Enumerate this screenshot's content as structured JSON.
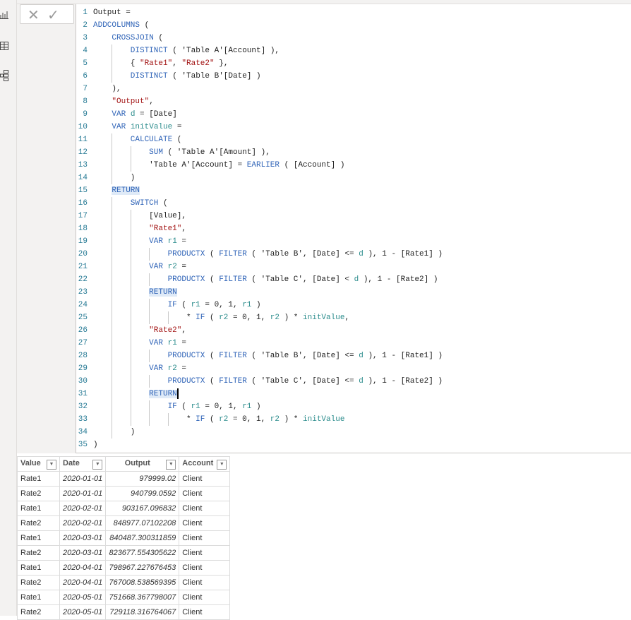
{
  "sidebar": {
    "icons": [
      "report-view-icon",
      "table-view-icon",
      "model-view-icon"
    ]
  },
  "formula_bar": {
    "cancel_icon": "✕",
    "commit_icon": "✓"
  },
  "editor": {
    "cursor_line": 31,
    "lines": [
      {
        "indent": 0,
        "tokens": [
          [
            "t",
            "Output ="
          ]
        ]
      },
      {
        "indent": 0,
        "tokens": [
          [
            "k",
            "ADDCOLUMNS"
          ],
          [
            "t",
            " ("
          ]
        ]
      },
      {
        "indent": 1,
        "tokens": [
          [
            "k",
            "CROSSJOIN"
          ],
          [
            "t",
            " ("
          ]
        ]
      },
      {
        "indent": 2,
        "tokens": [
          [
            "k",
            "DISTINCT"
          ],
          [
            "t",
            " ( 'Table A'[Account] ),"
          ]
        ]
      },
      {
        "indent": 2,
        "tokens": [
          [
            "t",
            "{ "
          ],
          [
            "s",
            "\"Rate1\""
          ],
          [
            "t",
            ", "
          ],
          [
            "s",
            "\"Rate2\""
          ],
          [
            "t",
            " },"
          ]
        ]
      },
      {
        "indent": 2,
        "tokens": [
          [
            "k",
            "DISTINCT"
          ],
          [
            "t",
            " ( 'Table B'[Date] )"
          ]
        ]
      },
      {
        "indent": 1,
        "tokens": [
          [
            "t",
            "),"
          ]
        ]
      },
      {
        "indent": 1,
        "tokens": [
          [
            "s",
            "\"Output\""
          ],
          [
            "t",
            ","
          ]
        ]
      },
      {
        "indent": 1,
        "tokens": [
          [
            "k",
            "VAR"
          ],
          [
            "t",
            " "
          ],
          [
            "v",
            "d"
          ],
          [
            "t",
            " = [Date]"
          ]
        ]
      },
      {
        "indent": 1,
        "tokens": [
          [
            "k",
            "VAR"
          ],
          [
            "t",
            " "
          ],
          [
            "v",
            "initValue"
          ],
          [
            "t",
            " ="
          ]
        ]
      },
      {
        "indent": 2,
        "tokens": [
          [
            "k",
            "CALCULATE"
          ],
          [
            "t",
            " ("
          ]
        ]
      },
      {
        "indent": 3,
        "tokens": [
          [
            "k",
            "SUM"
          ],
          [
            "t",
            " ( 'Table A'[Amount] ),"
          ]
        ]
      },
      {
        "indent": 3,
        "tokens": [
          [
            "t",
            "'Table A'[Account] = "
          ],
          [
            "k",
            "EARLIER"
          ],
          [
            "t",
            " ( [Account] )"
          ]
        ]
      },
      {
        "indent": 2,
        "tokens": [
          [
            "t",
            ")"
          ]
        ]
      },
      {
        "indent": 1,
        "tokens": [
          [
            "k",
            "RETURN"
          ]
        ],
        "highlight": true
      },
      {
        "indent": 2,
        "tokens": [
          [
            "k",
            "SWITCH"
          ],
          [
            "t",
            " ("
          ]
        ]
      },
      {
        "indent": 3,
        "tokens": [
          [
            "t",
            "[Value],"
          ]
        ]
      },
      {
        "indent": 3,
        "tokens": [
          [
            "s",
            "\"Rate1\""
          ],
          [
            "t",
            ","
          ]
        ]
      },
      {
        "indent": 3,
        "tokens": [
          [
            "k",
            "VAR"
          ],
          [
            "t",
            " "
          ],
          [
            "v",
            "r1"
          ],
          [
            "t",
            " ="
          ]
        ]
      },
      {
        "indent": 4,
        "tokens": [
          [
            "k",
            "PRODUCTX"
          ],
          [
            "t",
            " ( "
          ],
          [
            "k",
            "FILTER"
          ],
          [
            "t",
            " ( 'Table B', [Date] <= "
          ],
          [
            "v",
            "d"
          ],
          [
            "t",
            " ), 1 - [Rate1] )"
          ]
        ]
      },
      {
        "indent": 3,
        "tokens": [
          [
            "k",
            "VAR"
          ],
          [
            "t",
            " "
          ],
          [
            "v",
            "r2"
          ],
          [
            "t",
            " ="
          ]
        ]
      },
      {
        "indent": 4,
        "tokens": [
          [
            "k",
            "PRODUCTX"
          ],
          [
            "t",
            " ( "
          ],
          [
            "k",
            "FILTER"
          ],
          [
            "t",
            " ( 'Table C', [Date] < "
          ],
          [
            "v",
            "d"
          ],
          [
            "t",
            " ), 1 - [Rate2] )"
          ]
        ]
      },
      {
        "indent": 3,
        "tokens": [
          [
            "k",
            "RETURN"
          ]
        ],
        "highlight": true
      },
      {
        "indent": 4,
        "tokens": [
          [
            "k",
            "IF"
          ],
          [
            "t",
            " ( "
          ],
          [
            "v",
            "r1"
          ],
          [
            "t",
            " = 0, 1, "
          ],
          [
            "v",
            "r1"
          ],
          [
            "t",
            " )"
          ]
        ]
      },
      {
        "indent": 5,
        "tokens": [
          [
            "t",
            "* "
          ],
          [
            "k",
            "IF"
          ],
          [
            "t",
            " ( "
          ],
          [
            "v",
            "r2"
          ],
          [
            "t",
            " = 0, 1, "
          ],
          [
            "v",
            "r2"
          ],
          [
            "t",
            " ) * "
          ],
          [
            "v",
            "initValue"
          ],
          [
            "t",
            ","
          ]
        ]
      },
      {
        "indent": 3,
        "tokens": [
          [
            "s",
            "\"Rate2\""
          ],
          [
            "t",
            ","
          ]
        ]
      },
      {
        "indent": 3,
        "tokens": [
          [
            "k",
            "VAR"
          ],
          [
            "t",
            " "
          ],
          [
            "v",
            "r1"
          ],
          [
            "t",
            " ="
          ]
        ]
      },
      {
        "indent": 4,
        "tokens": [
          [
            "k",
            "PRODUCTX"
          ],
          [
            "t",
            " ( "
          ],
          [
            "k",
            "FILTER"
          ],
          [
            "t",
            " ( 'Table B', [Date] <= "
          ],
          [
            "v",
            "d"
          ],
          [
            "t",
            " ), 1 - [Rate1] )"
          ]
        ]
      },
      {
        "indent": 3,
        "tokens": [
          [
            "k",
            "VAR"
          ],
          [
            "t",
            " "
          ],
          [
            "v",
            "r2"
          ],
          [
            "t",
            " ="
          ]
        ]
      },
      {
        "indent": 4,
        "tokens": [
          [
            "k",
            "PRODUCTX"
          ],
          [
            "t",
            " ( "
          ],
          [
            "k",
            "FILTER"
          ],
          [
            "t",
            " ( 'Table C', [Date] <= "
          ],
          [
            "v",
            "d"
          ],
          [
            "t",
            " ), 1 - [Rate2] )"
          ]
        ]
      },
      {
        "indent": 3,
        "tokens": [
          [
            "k",
            "RETURN"
          ]
        ],
        "highlight": true
      },
      {
        "indent": 4,
        "tokens": [
          [
            "k",
            "IF"
          ],
          [
            "t",
            " ( "
          ],
          [
            "v",
            "r1"
          ],
          [
            "t",
            " = 0, 1, "
          ],
          [
            "v",
            "r1"
          ],
          [
            "t",
            " )"
          ]
        ]
      },
      {
        "indent": 5,
        "tokens": [
          [
            "t",
            "* "
          ],
          [
            "k",
            "IF"
          ],
          [
            "t",
            " ( "
          ],
          [
            "v",
            "r2"
          ],
          [
            "t",
            " = 0, 1, "
          ],
          [
            "v",
            "r2"
          ],
          [
            "t",
            " ) * "
          ],
          [
            "v",
            "initValue"
          ]
        ]
      },
      {
        "indent": 2,
        "tokens": [
          [
            "t",
            ")"
          ]
        ]
      },
      {
        "indent": 0,
        "tokens": [
          [
            "t",
            ")"
          ]
        ]
      }
    ]
  },
  "table": {
    "columns": [
      "Value",
      "Date",
      "Output",
      "Account"
    ],
    "filter_icon": "▼",
    "rows": [
      [
        "Rate1",
        "2020-01-01",
        "979999.02",
        "Client"
      ],
      [
        "Rate2",
        "2020-01-01",
        "940799.0592",
        "Client"
      ],
      [
        "Rate1",
        "2020-02-01",
        "903167.096832",
        "Client"
      ],
      [
        "Rate2",
        "2020-02-01",
        "848977.07102208",
        "Client"
      ],
      [
        "Rate1",
        "2020-03-01",
        "840487.300311859",
        "Client"
      ],
      [
        "Rate2",
        "2020-03-01",
        "823677.554305622",
        "Client"
      ],
      [
        "Rate1",
        "2020-04-01",
        "798967.227676453",
        "Client"
      ],
      [
        "Rate2",
        "2020-04-01",
        "767008.538569395",
        "Client"
      ],
      [
        "Rate1",
        "2020-05-01",
        "751668.367798007",
        "Client"
      ],
      [
        "Rate2",
        "2020-05-01",
        "729118.316764067",
        "Client"
      ]
    ]
  }
}
